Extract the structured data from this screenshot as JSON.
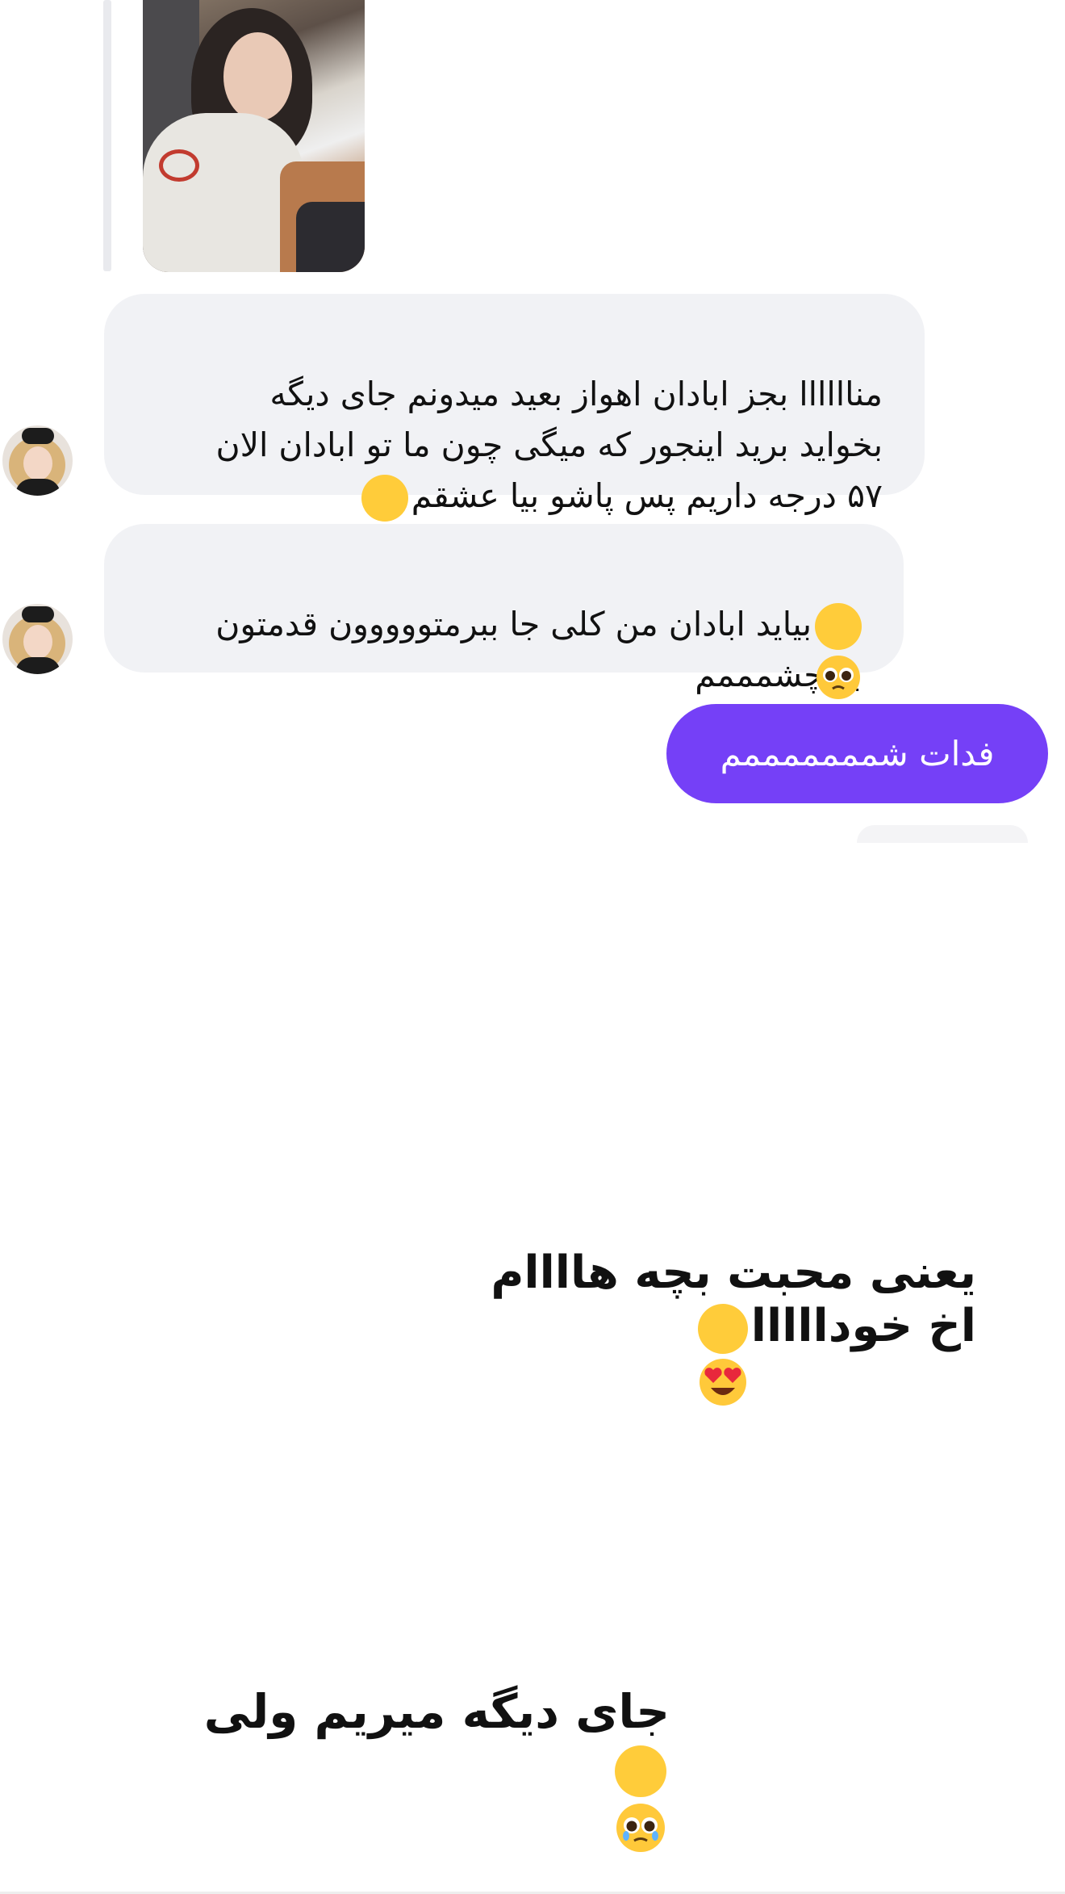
{
  "messages": [
    {
      "sender": "them",
      "type": "image"
    },
    {
      "sender": "them",
      "text": "مناااااا بجز ابادان اهواز بعید میدونم جای دیگه\nبخواید برید اینجور که میگی چون ما تو ابادان الان\n۵۷ درجه داریم پس پاشو بیا عشقم",
      "emoji": "face-with-tears-of-joy"
    },
    {
      "sender": "them",
      "text": "بیاید ابادان من کلی جا ببرمتووووون قدمتون\nبه چشمممم",
      "emoji": "pleading-face"
    },
    {
      "sender": "me",
      "text": "فدات شمممممممم"
    }
  ],
  "overlay": {
    "line1": "یعنی محبت بچه هاااام\nاخ خودااااا",
    "line1_emoji": "heart-eyes-emoji",
    "line2": "جای دیگه میریم ولی",
    "line2_emoji": "pleading-emoji"
  },
  "colors": {
    "incoming_bubble": "#f1f2f5",
    "outgoing_bubble": "#7540f7",
    "outgoing_text": "#ffffff"
  }
}
